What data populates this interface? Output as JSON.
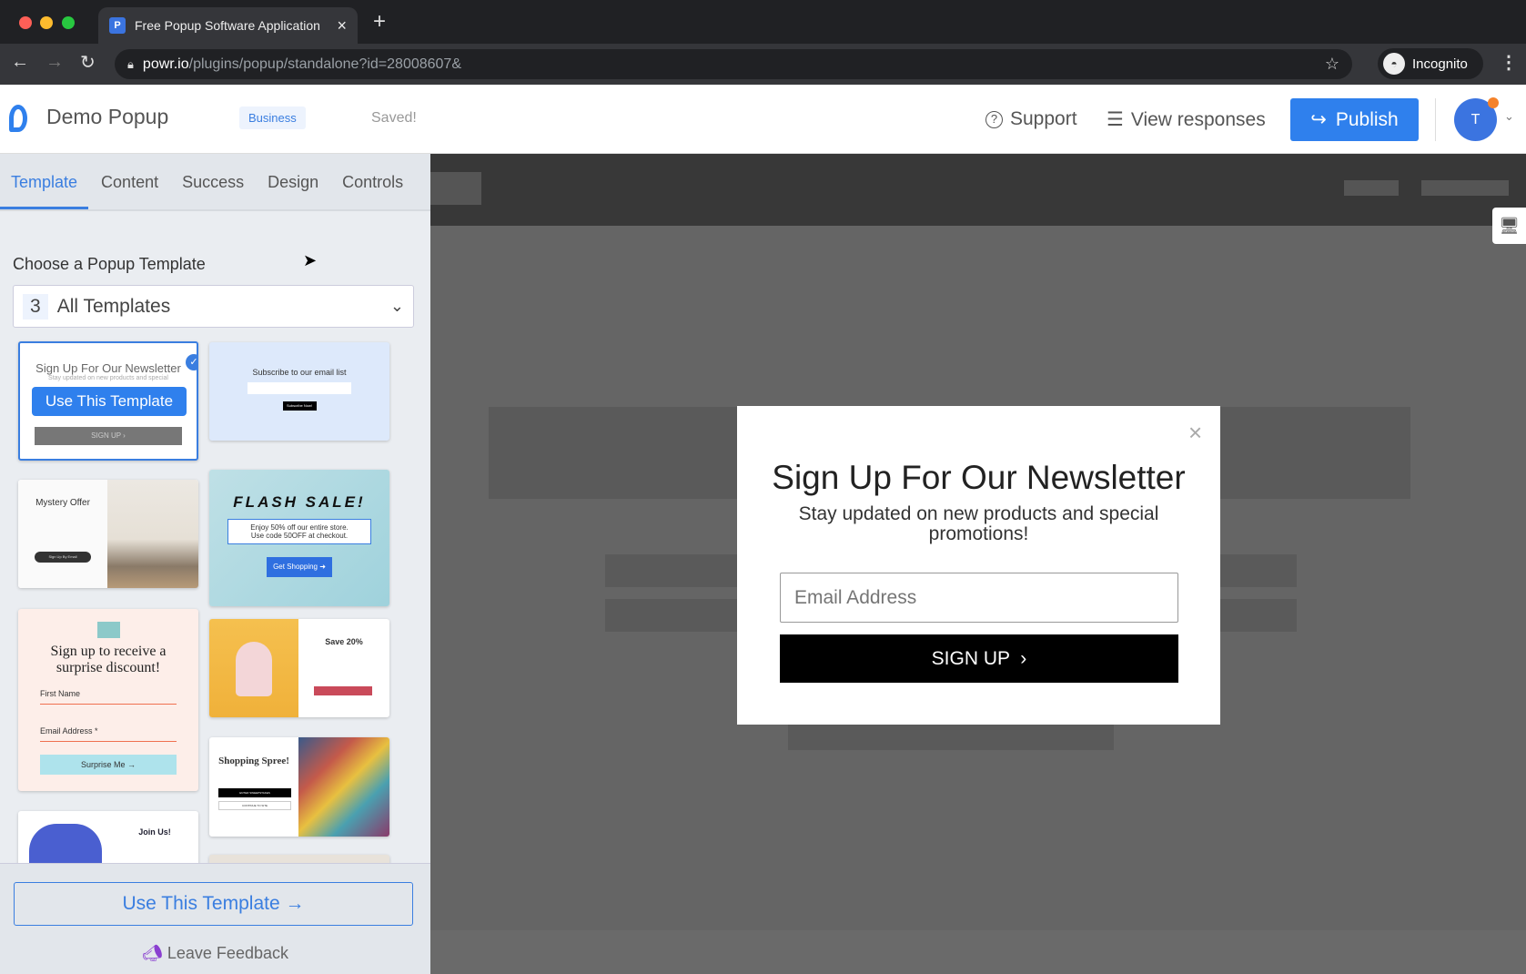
{
  "browser": {
    "tab_title": "Free Popup Software Application",
    "url_host": "powr.io",
    "url_path": "/plugins/popup/standalone?id=28008607&",
    "profile_label": "Incognito"
  },
  "header": {
    "app_name": "Demo Popup",
    "plan_badge": "Business",
    "save_status": "Saved!",
    "support": "Support",
    "view_responses": "View responses",
    "publish": "Publish",
    "avatar_initial": "T",
    "accent": "#2f80ed"
  },
  "sidebar": {
    "tabs": [
      "Template",
      "Content",
      "Success",
      "Design",
      "Controls"
    ],
    "section_label": "Choose a Popup Template",
    "dropdown": {
      "count": "3",
      "value": "All Templates"
    },
    "templates": {
      "newsletter": {
        "title": "Sign Up For Our Newsletter",
        "subtitle": "Stay updated on new products and special",
        "hover_button": "Use This Template",
        "button": "SIGN UP ›"
      },
      "subscribe": {
        "title": "Subscribe to our email list",
        "button": "Subscribe Now!"
      },
      "mystery": {
        "title": "Mystery Offer",
        "button": "Sign Up By Email"
      },
      "flash": {
        "title": "FLASH SALE!",
        "line1": "Enjoy 50% off our entire store.",
        "line2": "Use code 50OFF at checkout.",
        "button": "Get Shopping ➜"
      },
      "surprise": {
        "title": "Sign up to receive a surprise discount!",
        "field1": "First Name",
        "field2": "Email Address *",
        "button": "Surprise Me →"
      },
      "save20": {
        "title": "Save 20%"
      },
      "spree": {
        "title": "Shopping Spree!",
        "button": "ENTER SWEEPSTAKES",
        "button2": "CONTINUE TO SITE"
      },
      "join": {
        "title": "Join Us!"
      }
    },
    "use_template": "Use This Template →",
    "feedback": "Leave Feedback"
  },
  "popup": {
    "title": "Sign Up For Our Newsletter",
    "subtitle": "Stay updated on new products and special promotions!",
    "email_placeholder": "Email Address",
    "button": "SIGN UP  ›"
  }
}
